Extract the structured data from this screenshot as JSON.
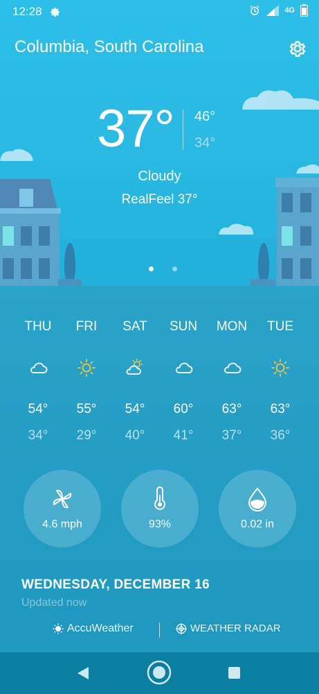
{
  "status": {
    "time": "12:28",
    "network": "4G",
    "icons": [
      "gear-icon",
      "alarm-icon",
      "signal-icon",
      "battery-icon"
    ]
  },
  "header": {
    "location": "Columbia, South Carolina"
  },
  "current": {
    "temp": "37°",
    "high": "46°",
    "low": "34°",
    "condition": "Cloudy",
    "realfeel": "RealFeel 37°"
  },
  "pager": {
    "pages": 2,
    "active": 1
  },
  "forecast": [
    {
      "day": "THU",
      "icon": "cloud-icon",
      "high": "54°",
      "low": "34°"
    },
    {
      "day": "FRI",
      "icon": "sun-icon",
      "high": "55°",
      "low": "29°"
    },
    {
      "day": "SAT",
      "icon": "partly-sunny-icon",
      "high": "54°",
      "low": "40°"
    },
    {
      "day": "SUN",
      "icon": "cloud-icon",
      "high": "60°",
      "low": "41°"
    },
    {
      "day": "MON",
      "icon": "cloud-icon",
      "high": "63°",
      "low": "37°"
    },
    {
      "day": "TUE",
      "icon": "sun-icon",
      "high": "63°",
      "low": "36°"
    }
  ],
  "details": {
    "wind": "4.6 mph",
    "humidity": "93%",
    "precip": "0.02 in"
  },
  "date_label": "WEDNESDAY, DECEMBER 16",
  "updated": "Updated now",
  "brands": {
    "accuweather": "AccuWeather",
    "radar": "WEATHER RADAR"
  },
  "colors": {
    "sky": "#29b9e3",
    "lower": "#1e98bf",
    "sun": "#f5c542",
    "nav": "#0b7fa1"
  }
}
